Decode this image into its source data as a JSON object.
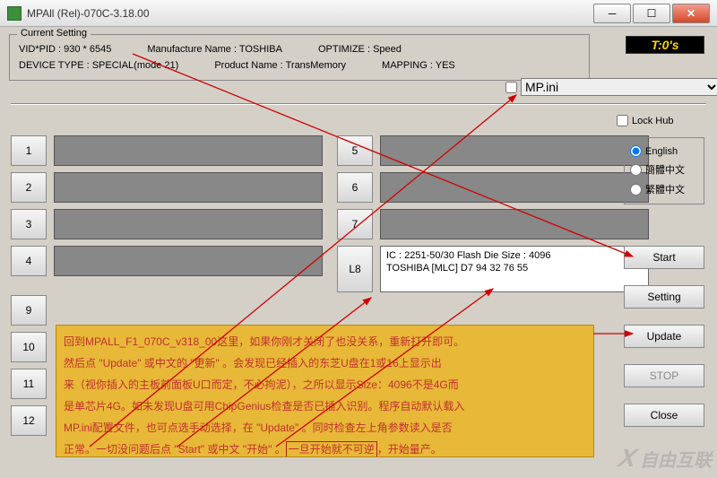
{
  "window": {
    "title": "MPAll (Rel)-070C-3.18.00",
    "minimize": "─",
    "maximize": "☐",
    "close": "✕"
  },
  "timer": "T:0's",
  "current_setting": {
    "legend": "Current Setting",
    "vid_pid": "VID*PID : 930 * 6545",
    "manufacture": "Manufacture Name : TOSHIBA",
    "optimize": "OPTIMIZE : Speed",
    "device_type": "DEVICE TYPE : SPECIAL(mode 21)",
    "product_name": "Product Name : TransMemory",
    "mapping": "MAPPING : YES"
  },
  "config": {
    "file": "MP.ini"
  },
  "lock_hub": "Lock Hub",
  "lang": {
    "english": "English",
    "simplified": "簡體中文",
    "traditional": "繁體中文"
  },
  "slots": {
    "left": [
      "1",
      "2",
      "3",
      "4",
      "9",
      "10",
      "11",
      "12"
    ],
    "right": [
      "5",
      "6",
      "7",
      "L8"
    ],
    "info_line1": "IC : 2251-50/30  Flash Die Size : 4096",
    "info_line2": "TOSHIBA [MLC] D7 94 32 76 55"
  },
  "actions": {
    "start": "Start",
    "setting": "Setting",
    "update": "Update",
    "stop": "STOP",
    "close": "Close"
  },
  "instruction": {
    "p1": "回到MPALL_F1_070C_v318_00这里，如果你刚才关闭了也没关系，重新打开即可。",
    "p2": "然后点 \"Update\" 或中文的 \"更新\" 。会发现已经插入的东芝U盘在1或16上显示出",
    "p3": "来（视你插入的主板前面板U口而定，不必拘泥），之所以显示Size：4096不是4G而",
    "p4": "是单芯片4G。如未发现U盘可用ChipGenius检查是否已插入识别。程序自动默认载入",
    "p5": "MP.ini配置文件，也可点选手动选择，在 \"Update\" 。同时检查左上角参数读入是否",
    "p6a": "正常。一切没问题后点 \"Start\" 或中文 \"开始\" 。",
    "p6b": "一旦开始就不可逆",
    "p6c": "，开始量产。"
  },
  "watermark": "自由互联"
}
